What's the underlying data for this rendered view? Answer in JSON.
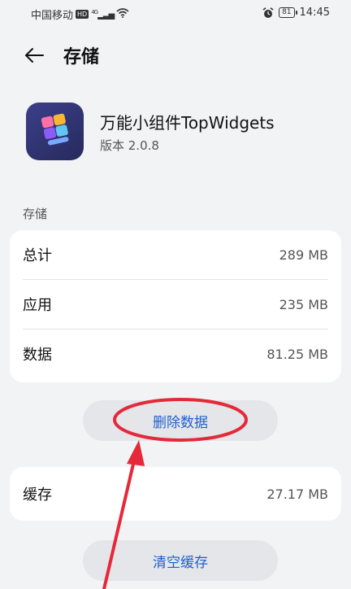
{
  "status_bar": {
    "carrier": "中国移动",
    "hd": "HD",
    "signal_type": "4G",
    "battery": "81",
    "time": "14:45"
  },
  "header": {
    "title": "存储"
  },
  "app": {
    "name": "万能小组件TopWidgets",
    "version": "版本 2.0.8"
  },
  "storage_section": {
    "label": "存储",
    "rows": [
      {
        "label": "总计",
        "value": "289 MB"
      },
      {
        "label": "应用",
        "value": "235 MB"
      },
      {
        "label": "数据",
        "value": "81.25 MB"
      }
    ]
  },
  "delete_data_button": "删除数据",
  "cache": {
    "label": "缓存",
    "value": "27.17 MB"
  },
  "clear_cache_button": "清空缓存",
  "colors": {
    "background": "#f1f3f5",
    "card": "#ffffff",
    "button_text": "#1f5fcf",
    "annotation": "#e5283a"
  }
}
